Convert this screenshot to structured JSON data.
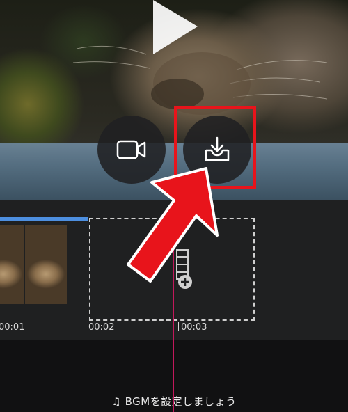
{
  "preview": {
    "play_icon": "play-icon",
    "record_icon": "video-camera-icon",
    "save_icon": "download-tray-icon"
  },
  "timeline": {
    "ticks": [
      "00:01",
      "00:02",
      "00:03"
    ]
  },
  "bgm": {
    "label": "BGMを設定しましょう",
    "icon": "music-note-icon"
  },
  "colors": {
    "accent_blue": "#4d8fe0",
    "playhead": "#c2185b",
    "highlight_red": "#e8141b"
  }
}
